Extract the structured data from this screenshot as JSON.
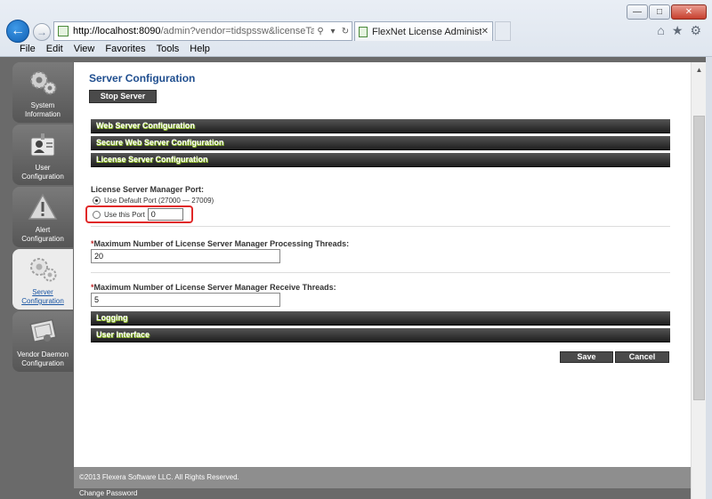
{
  "browser": {
    "window_buttons": {
      "minimize": "—",
      "maximize": "□",
      "close": "✕"
    },
    "address": {
      "host": "http://localhost:8090",
      "path": "/admin?vendor=tidspssw&licenseTab=&selecte",
      "search_glyph": "⚲",
      "dropdown_glyph": "▾",
      "refresh_glyph": "↻"
    },
    "tab": {
      "label": "FlexNet License Administra...",
      "close_glyph": "✕"
    },
    "toolbar_icons": {
      "home": "⌂",
      "favorites": "★",
      "settings": "⚙"
    },
    "menu": [
      "File",
      "Edit",
      "View",
      "Favorites",
      "Tools",
      "Help"
    ]
  },
  "left_nav": [
    {
      "line1": "System",
      "line2": "Information",
      "icon": "gears-icon",
      "active": false
    },
    {
      "line1": "User",
      "line2": "Configuration",
      "icon": "user-id-icon",
      "active": false
    },
    {
      "line1": "Alert",
      "line2": "Configuration",
      "icon": "alert-icon",
      "active": false
    },
    {
      "line1": "Server",
      "line2": "Configuration",
      "icon": "gears-icon",
      "active": true
    },
    {
      "line1": "Vendor Daemon",
      "line2": "Configuration",
      "icon": "certificate-icon",
      "active": false
    }
  ],
  "main": {
    "title": "Server Configuration",
    "stop_button": "Stop Server",
    "sections_top": [
      "Web Server Configuration",
      "Secure Web Server Configuration",
      "License Server Configuration"
    ],
    "port_label": "License Server Manager Port:",
    "default_port_option": "Use Default Port (27000 — 27009)",
    "custom_port_option": "Use this Port",
    "custom_port_value": "0",
    "required_mark": "*",
    "processing_threads_label": "Maximum Number of License Server Manager Processing Threads:",
    "processing_threads_value": "20",
    "receive_threads_label": "Maximum Number of License Server Manager Receive Threads:",
    "receive_threads_value": "5",
    "sections_bottom": [
      "Logging",
      "User Interface"
    ],
    "save_button": "Save",
    "cancel_button": "Cancel",
    "footer": "©2013 Flexera Software LLC. All Rights Reserved.",
    "change_password": "Change Password"
  },
  "colors": {
    "title_blue": "#1f4e8f",
    "section_bar": "#2a2a2a",
    "highlight_red": "#e02828",
    "nav_active_link": "#1b56a3"
  }
}
